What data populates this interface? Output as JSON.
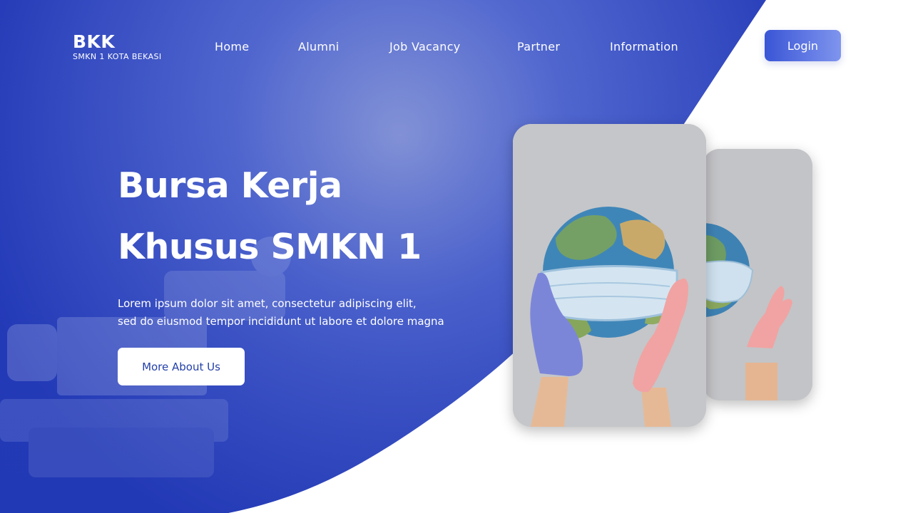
{
  "logo": {
    "title": "BKK",
    "subtitle": "SMKN 1 KOTA BEKASI"
  },
  "nav": [
    {
      "label": "Home"
    },
    {
      "label": "Alumni"
    },
    {
      "label": "Job Vacancy"
    },
    {
      "label": "Partner"
    },
    {
      "label": "Information"
    }
  ],
  "login": {
    "label": "Login"
  },
  "hero": {
    "title_lines": [
      "Bursa Kerja",
      "Khusus SMKN 1"
    ],
    "description_lines": [
      "Lorem ipsum dolor sit amet, consectetur adipiscing elit,",
      "sed do eiusmod tempor incididunt ut labore et dolore magna"
    ],
    "cta_label": "More About Us"
  },
  "photo": {
    "subject": "globe-with-face-mask-held-by-gloved-hands"
  },
  "colors": {
    "primary": "#2b45c4",
    "primary_dark": "#1f37b0",
    "accent_light": "#7f95ee",
    "cta_text": "#2340a8",
    "white": "#ffffff"
  }
}
